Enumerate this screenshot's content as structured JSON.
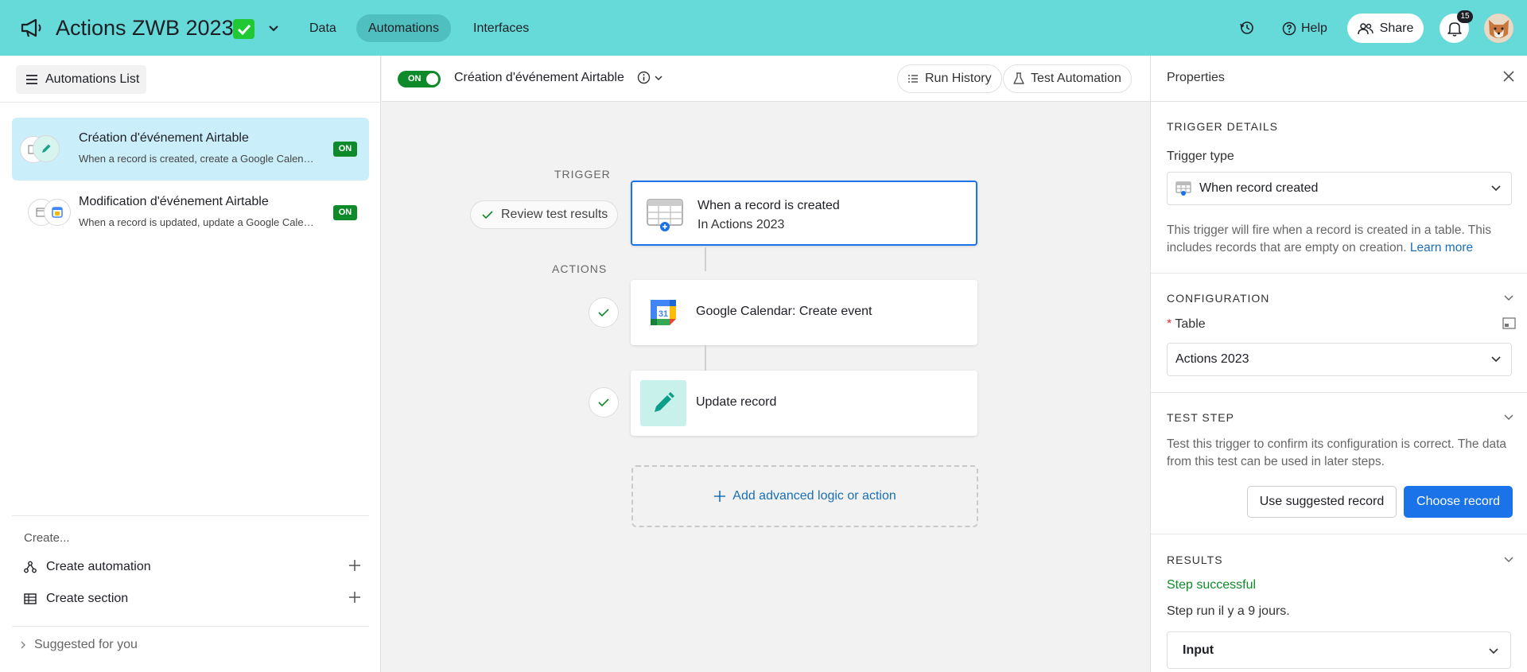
{
  "topbar": {
    "title": "Actions ZWB 2023",
    "tabs": [
      {
        "label": "Data"
      },
      {
        "label": "Automations"
      },
      {
        "label": "Interfaces"
      }
    ],
    "help_label": "Help",
    "share_label": "Share",
    "notification_count": "15",
    "colors": {
      "bar": "#66d9d9",
      "active_tab": "#4fbfbf",
      "check": "#20c933"
    }
  },
  "sidebar": {
    "list_button_label": "Automations List",
    "automations": [
      {
        "title": "Création d'événement Airtable",
        "subtitle": "When a record is created, create a Google Calendar event",
        "status": "ON"
      },
      {
        "title": "Modification d'événement Airtable",
        "subtitle": "When a record is updated, update a Google Calendar event",
        "status": "ON"
      }
    ],
    "create_label": "Create...",
    "create_items": [
      {
        "label": "Create automation"
      },
      {
        "label": "Create section"
      }
    ],
    "suggested_label": "Suggested for you"
  },
  "toolbar": {
    "toggle_label": "ON",
    "automation_title": "Création d'événement Airtable",
    "run_history_label": "Run History",
    "test_automation_label": "Test Automation"
  },
  "canvas": {
    "trigger_label": "TRIGGER",
    "actions_label": "ACTIONS",
    "review_label": "Review test results",
    "trigger_step": {
      "title": "When a record is created",
      "subtitle": "In Actions 2023"
    },
    "action_steps": [
      {
        "title": "Google Calendar: Create event",
        "icon": "google-calendar-icon"
      },
      {
        "title": "Update record",
        "icon": "pencil-icon"
      }
    ],
    "calendar_day": "31",
    "add_label": "Add advanced logic or action"
  },
  "properties": {
    "title": "Properties",
    "trigger_details_label": "TRIGGER DETAILS",
    "trigger_type_label": "Trigger type",
    "trigger_type_value": "When record created",
    "trigger_description": "This trigger will fire when a record is created in a table. This includes records that are empty on creation.",
    "learn_more": "Learn more",
    "configuration_label": "CONFIGURATION",
    "table_required": "*",
    "table_label": "Table",
    "table_value": "Actions 2023",
    "test_step_label": "TEST STEP",
    "test_step_description": "Test this trigger to confirm its configuration is correct. The data from this test can be used in later steps.",
    "use_suggested_label": "Use suggested record",
    "choose_record_label": "Choose record",
    "results_label": "RESULTS",
    "results_status": "Step successful",
    "results_time": "Step run il y a 9 jours.",
    "input_label": "Input"
  }
}
